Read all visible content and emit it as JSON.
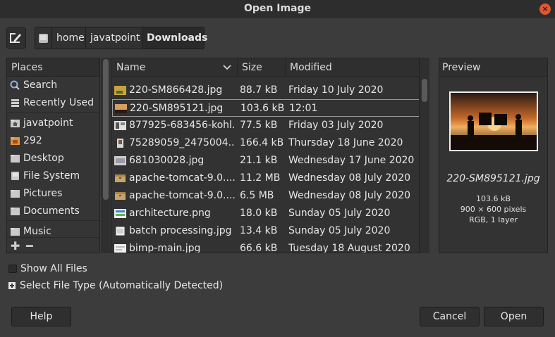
{
  "window": {
    "title": "Open Image"
  },
  "path": {
    "crumbs": [
      "home",
      "javatpoint",
      "Downloads"
    ]
  },
  "places": {
    "header": "Places",
    "items": [
      {
        "label": "Search",
        "icon": "search-icon"
      },
      {
        "label": "Recently Used",
        "icon": "recent-icon"
      },
      {
        "label": "javatpoint",
        "icon": "folder-home-icon"
      },
      {
        "label": "292",
        "icon": "folder-icon"
      },
      {
        "label": "Desktop",
        "icon": "desktop-icon"
      },
      {
        "label": "File System",
        "icon": "drive-icon"
      },
      {
        "label": "Pictures",
        "icon": "folder-icon"
      },
      {
        "label": "Documents",
        "icon": "folder-icon"
      },
      {
        "label": "Music",
        "icon": "folder-icon"
      }
    ]
  },
  "files": {
    "columns": {
      "name": "Name",
      "size": "Size",
      "modified": "Modified"
    },
    "rows": [
      {
        "name": "220-SM866428.jpg",
        "size": "88.7 kB",
        "modified": "Friday 10 July 2020",
        "selected": false
      },
      {
        "name": "220-SM895121.jpg",
        "size": "103.6 kB",
        "modified": "12:01",
        "selected": true
      },
      {
        "name": "877925-683456-kohl...",
        "size": "77.5 kB",
        "modified": "Friday 03 July 2020",
        "selected": false
      },
      {
        "name": "75289059_2475004...",
        "size": "166.4 kB",
        "modified": "Thursday 18 June 2020",
        "selected": false
      },
      {
        "name": "681030028.jpg",
        "size": "21.1 kB",
        "modified": "Wednesday 17 June 2020",
        "selected": false
      },
      {
        "name": "apache-tomcat-9.0....",
        "size": "11.2 MB",
        "modified": "Wednesday 08 July 2020",
        "selected": false
      },
      {
        "name": "apache-tomcat-9.0....",
        "size": "6.5 MB",
        "modified": "Wednesday 08 July 2020",
        "selected": false
      },
      {
        "name": "architecture.png",
        "size": "18.0 kB",
        "modified": "Sunday 05 July 2020",
        "selected": false
      },
      {
        "name": "batch processing.jpg",
        "size": "13.4 kB",
        "modified": "Sunday 05 July 2020",
        "selected": false
      },
      {
        "name": "bimp-main.jpg",
        "size": "66.6 kB",
        "modified": "Tuesday 18 August 2020",
        "selected": false
      }
    ]
  },
  "preview": {
    "header": "Preview",
    "filename": "220-SM895121.jpg",
    "size": "103.6 kB",
    "dimensions": "900 × 600 pixels",
    "mode": "RGB, 1 layer"
  },
  "options": {
    "show_all_files": "Show All Files",
    "select_file_type": "Select File Type (Automatically Detected)"
  },
  "buttons": {
    "help": "Help",
    "cancel": "Cancel",
    "open": "Open"
  }
}
